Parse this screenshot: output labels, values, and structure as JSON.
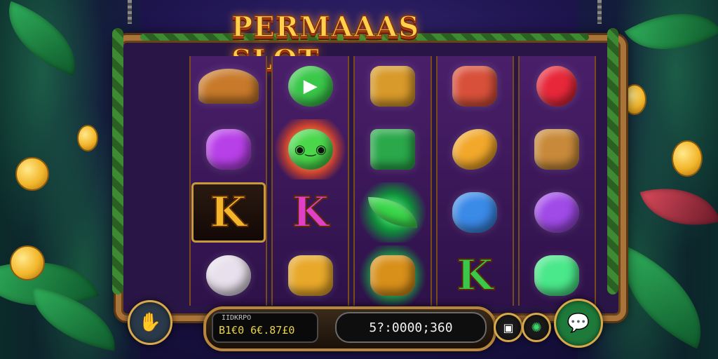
{
  "game": {
    "title": "PERMAAAS SLOT"
  },
  "reels": [
    {
      "symbols": [
        {
          "name": "hat",
          "color": "#c87a2a"
        },
        {
          "name": "purple-gem",
          "color": "#b840e8"
        },
        {
          "name": "k",
          "letter": "K",
          "color": "#f2b42a"
        },
        {
          "name": "white-pearl",
          "color": "#e8e0ec"
        }
      ]
    },
    {
      "symbols": [
        {
          "name": "green-play-ring",
          "color": "#3ac84a"
        },
        {
          "name": "frog-with-glasses",
          "color": "#4ad84a"
        },
        {
          "name": "k",
          "letter": "K",
          "color": "#e040c8"
        },
        {
          "name": "gold-flower",
          "color": "#e8a82a"
        }
      ]
    },
    {
      "symbols": [
        {
          "name": "gold-block",
          "color": "#d89a2a"
        },
        {
          "name": "green-chest",
          "color": "#2aa84a"
        },
        {
          "name": "green-leaf",
          "color": "#3ad84a"
        },
        {
          "name": "gold-scroll",
          "color": "#d8901a"
        }
      ]
    },
    {
      "symbols": [
        {
          "name": "red-mask",
          "color": "#d8503a"
        },
        {
          "name": "golden-fish",
          "color": "#f2a82a"
        },
        {
          "name": "blue-gem-bird",
          "color": "#3a8ae8"
        },
        {
          "name": "k",
          "letter": "K",
          "color": "#3ac84a"
        }
      ]
    },
    {
      "symbols": [
        {
          "name": "red-fruit",
          "color": "#e8283a"
        },
        {
          "name": "potion-jar",
          "color": "#c88a3a"
        },
        {
          "name": "purple-ring",
          "color": "#a04ae8"
        },
        {
          "name": "green-jade",
          "color": "#4ae88a"
        }
      ]
    }
  ],
  "hud": {
    "balance_label": "IIDKRPO",
    "balance_value": "B1€0 6€.87£0",
    "bet_value": "5?:0000;360"
  },
  "icons": {
    "hand": "hand-icon",
    "square": "square-icon",
    "settings": "settings-icon",
    "chat": "chat-icon"
  }
}
